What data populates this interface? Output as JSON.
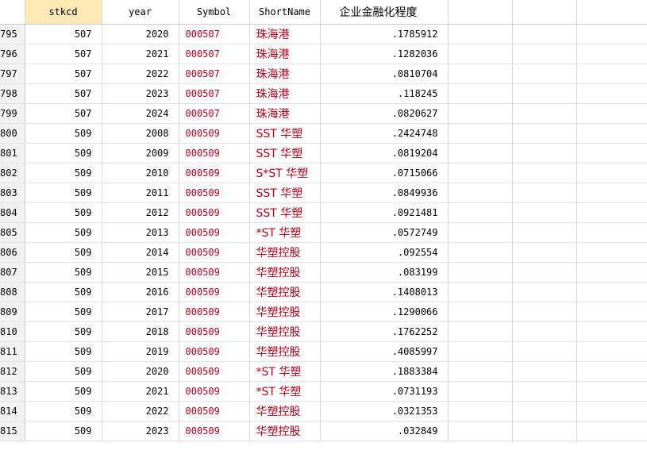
{
  "columns": [
    "stkcd",
    "year",
    "Symbol",
    "ShortName",
    "企业金融化程度"
  ],
  "rows": [
    {
      "n": "795",
      "stkcd": "507",
      "year": "2020",
      "symbol": "000507",
      "shortname": "珠海港",
      "fin": ".1785912"
    },
    {
      "n": "796",
      "stkcd": "507",
      "year": "2021",
      "symbol": "000507",
      "shortname": "珠海港",
      "fin": ".1282036"
    },
    {
      "n": "797",
      "stkcd": "507",
      "year": "2022",
      "symbol": "000507",
      "shortname": "珠海港",
      "fin": ".0810704"
    },
    {
      "n": "798",
      "stkcd": "507",
      "year": "2023",
      "symbol": "000507",
      "shortname": "珠海港",
      "fin": ".118245"
    },
    {
      "n": "799",
      "stkcd": "507",
      "year": "2024",
      "symbol": "000507",
      "shortname": "珠海港",
      "fin": ".0820627"
    },
    {
      "n": "800",
      "stkcd": "509",
      "year": "2008",
      "symbol": "000509",
      "shortname": "SST 华塑",
      "fin": ".2424748"
    },
    {
      "n": "801",
      "stkcd": "509",
      "year": "2009",
      "symbol": "000509",
      "shortname": "SST 华塑",
      "fin": ".0819204"
    },
    {
      "n": "802",
      "stkcd": "509",
      "year": "2010",
      "symbol": "000509",
      "shortname": "S*ST 华塑",
      "fin": ".0715066"
    },
    {
      "n": "803",
      "stkcd": "509",
      "year": "2011",
      "symbol": "000509",
      "shortname": "SST 华塑",
      "fin": ".0849936"
    },
    {
      "n": "804",
      "stkcd": "509",
      "year": "2012",
      "symbol": "000509",
      "shortname": "SST 华塑",
      "fin": ".0921481"
    },
    {
      "n": "805",
      "stkcd": "509",
      "year": "2013",
      "symbol": "000509",
      "shortname": "*ST 华塑",
      "fin": ".0572749"
    },
    {
      "n": "806",
      "stkcd": "509",
      "year": "2014",
      "symbol": "000509",
      "shortname": "华塑控股",
      "fin": ".092554"
    },
    {
      "n": "807",
      "stkcd": "509",
      "year": "2015",
      "symbol": "000509",
      "shortname": "华塑控股",
      "fin": ".083199"
    },
    {
      "n": "808",
      "stkcd": "509",
      "year": "2016",
      "symbol": "000509",
      "shortname": "华塑控股",
      "fin": ".1408013"
    },
    {
      "n": "809",
      "stkcd": "509",
      "year": "2017",
      "symbol": "000509",
      "shortname": "华塑控股",
      "fin": ".1290066"
    },
    {
      "n": "810",
      "stkcd": "509",
      "year": "2018",
      "symbol": "000509",
      "shortname": "华塑控股",
      "fin": ".1762252"
    },
    {
      "n": "811",
      "stkcd": "509",
      "year": "2019",
      "symbol": "000509",
      "shortname": "华塑控股",
      "fin": ".4085997"
    },
    {
      "n": "812",
      "stkcd": "509",
      "year": "2020",
      "symbol": "000509",
      "shortname": "*ST 华塑",
      "fin": ".1883384"
    },
    {
      "n": "813",
      "stkcd": "509",
      "year": "2021",
      "symbol": "000509",
      "shortname": "*ST 华塑",
      "fin": ".0731193"
    },
    {
      "n": "814",
      "stkcd": "509",
      "year": "2022",
      "symbol": "000509",
      "shortname": "华塑控股",
      "fin": ".0321353"
    },
    {
      "n": "815",
      "stkcd": "509",
      "year": "2023",
      "symbol": "000509",
      "shortname": "华塑控股",
      "fin": ".032849"
    }
  ],
  "colors": {
    "string_text": "#b2001b",
    "selected_header": "#fde8b6",
    "rownum_bg": "#f2f2f2"
  }
}
